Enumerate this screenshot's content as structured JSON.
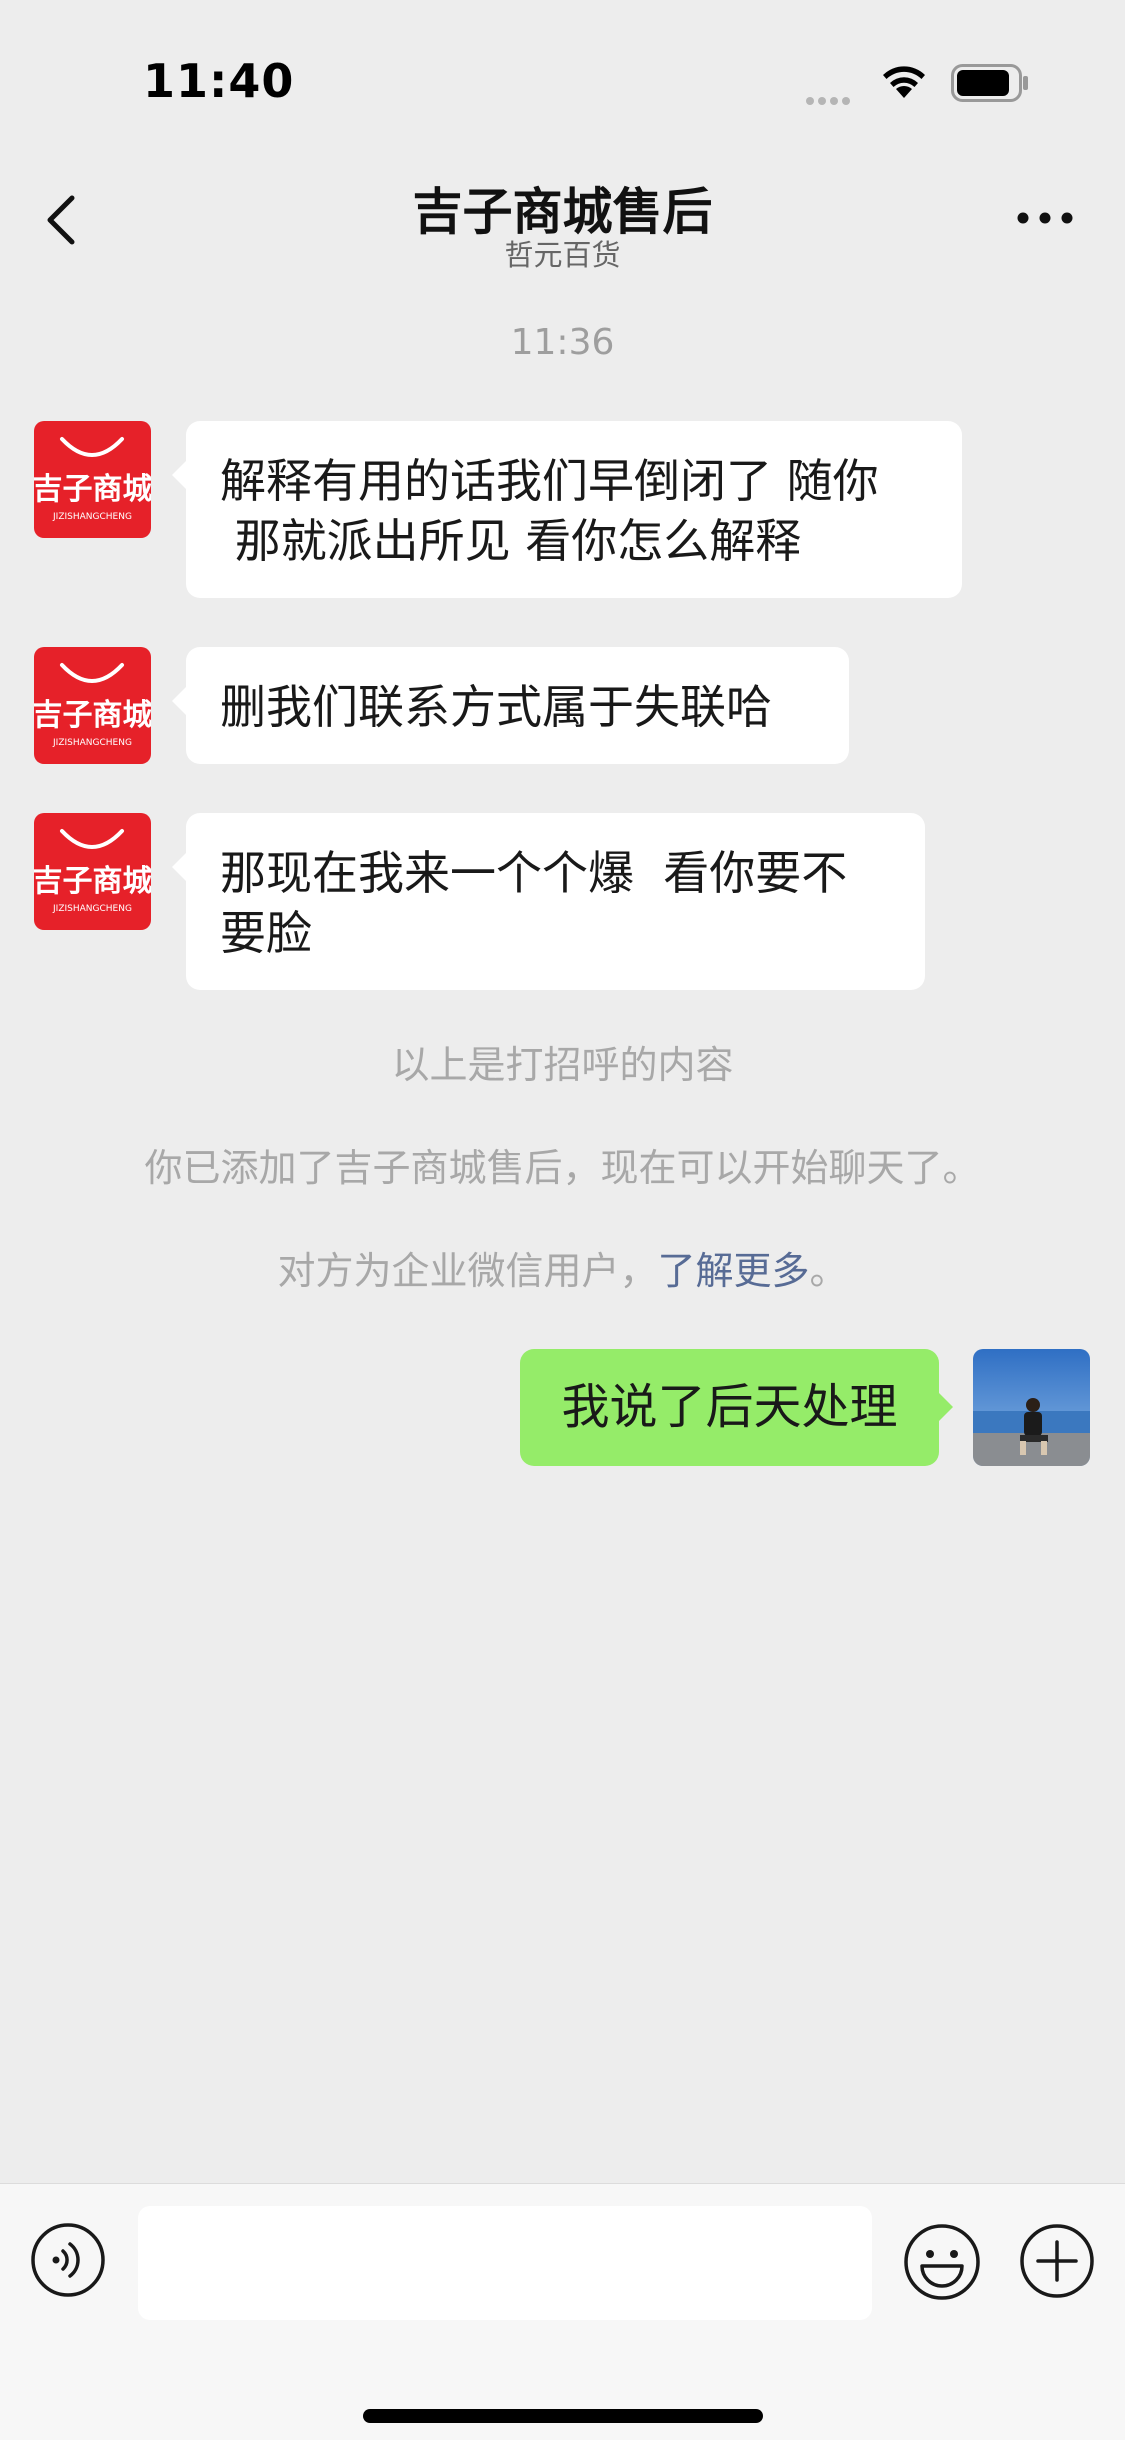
{
  "status_bar": {
    "time": "11:40"
  },
  "nav": {
    "title": "吉子商城售后",
    "subtitle": "哲元百货"
  },
  "chat": {
    "timestamp": "11:36",
    "contact_logo": {
      "name": "吉子商城",
      "sub": "JIZISHANGCHENG",
      "color": "#e62129"
    },
    "incoming": [
      {
        "line1": "解释有用的话我们早倒闭了 随你",
        "line2": " 那就派出所见 看你怎么解释"
      },
      {
        "line1": "删我们联系方式属于失联哈",
        "line2": ""
      },
      {
        "line1": "那现在我来一个个爆  看你要不",
        "line2": "要脸"
      }
    ],
    "system": {
      "greeting_note": "以上是打招呼的内容",
      "added_note": "你已添加了吉子商城售后，现在可以开始聊天了。",
      "wecom_prefix": "对方为企业微信用户，",
      "wecom_link": "了解更多",
      "wecom_suffix": "。"
    },
    "outgoing": [
      {
        "text": "我说了后天处理"
      }
    ]
  },
  "input": {
    "value": "",
    "placeholder": ""
  },
  "colors": {
    "background": "#ededed",
    "bubble_out": "#95ec69",
    "bubble_in": "#ffffff",
    "link": "#576b95",
    "brand_red": "#e62129"
  },
  "icons": [
    "signal-dots-icon",
    "wifi-icon",
    "battery-icon",
    "back-chevron-icon",
    "more-icon",
    "voice-icon",
    "emoji-icon",
    "plus-icon"
  ]
}
